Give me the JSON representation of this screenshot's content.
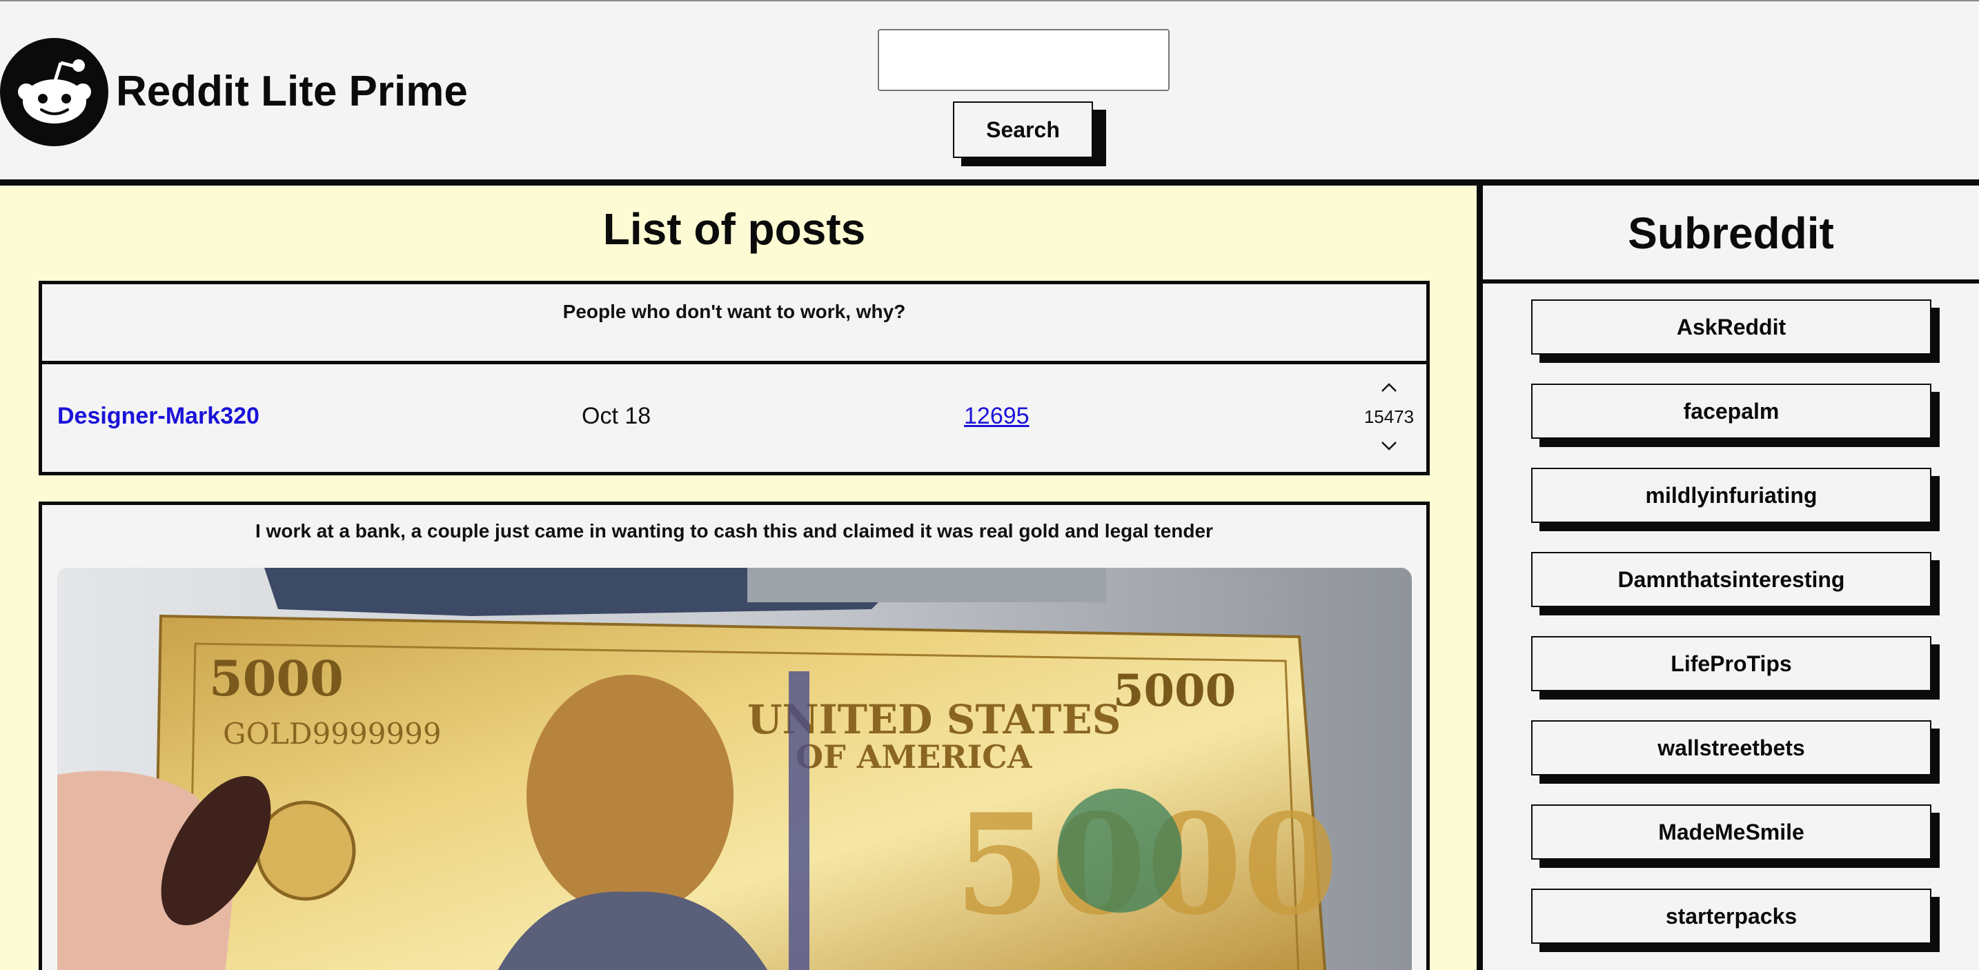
{
  "header": {
    "brand": "Reddit Lite Prime",
    "logo_icon": "reddit-alien-icon",
    "search": {
      "value": "",
      "placeholder": ""
    },
    "search_button": "Search"
  },
  "main": {
    "title": "List of posts",
    "posts": [
      {
        "title": "People who don't want to work, why?",
        "author": "Designer-Mark320",
        "date": "Oct 18",
        "comments": "12695",
        "score": "15473"
      },
      {
        "title": "I work at a bank, a couple just came in wanting to cash this and claimed it was real gold and legal tender",
        "image": "gold-5000-banknote-photo"
      }
    ]
  },
  "sidebar": {
    "title": "Subreddit",
    "subreddits": [
      "AskReddit",
      "facepalm",
      "mildlyinfuriating",
      "Damnthatsinteresting",
      "LifeProTips",
      "wallstreetbets",
      "MadeMeSmile",
      "starterpacks"
    ]
  },
  "colors": {
    "main_bg": "#fdfbd3",
    "page_bg": "#f4f4f4",
    "link": "#1a12d8",
    "border": "#0b0b0b"
  }
}
